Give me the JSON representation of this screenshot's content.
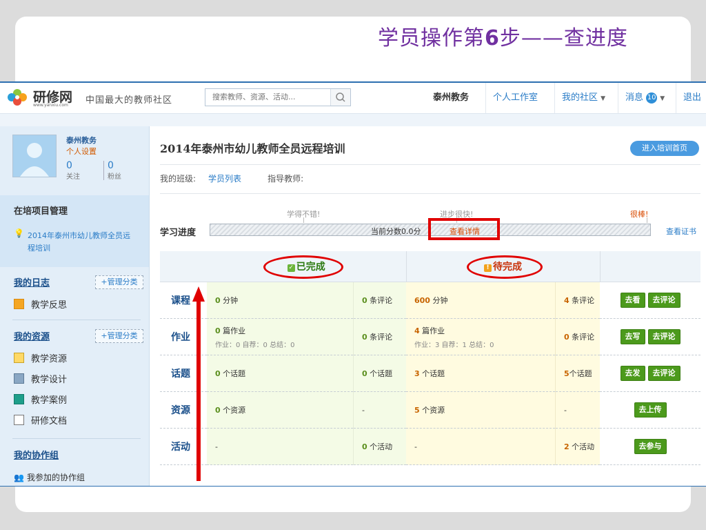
{
  "slide": {
    "title_prefix": "学员操作第",
    "title_num": "6",
    "title_suffix": "步——查进度"
  },
  "header": {
    "logo_text": "研修网",
    "logo_sub": "www.yanxiu.com",
    "slogan": "中国最大的教师社区",
    "search_placeholder": "搜索教师、资源、活动...",
    "nav_user": "泰州教务",
    "nav_studio": "个人工作室",
    "nav_community": "我的社区",
    "nav_messages": "消息",
    "msg_count": "10",
    "nav_logout": "退出"
  },
  "sidebar": {
    "name": "泰州教务",
    "settings": "个人设置",
    "follow_count": "0",
    "follow_label": "关注",
    "fans_count": "0",
    "fans_label": "粉丝",
    "project_title": "在培项目管理",
    "project_link_1": "2014年泰州市幼儿教师全员远",
    "project_link_2": "程培训",
    "diary_title": "我的日志",
    "manage_label": "+管理分类",
    "diary_item": "教学反思",
    "resource_title": "我的资源",
    "resource_items": [
      "教学资源",
      "教学设计",
      "教学案例",
      "研修文档"
    ],
    "group_title": "我的协作组",
    "group_item": "我参加的协作组"
  },
  "main": {
    "title": "2014年泰州市幼儿教师全员远程培训",
    "enter_button": "进入培训首页",
    "class_label": "我的班级:",
    "student_list": "学员列表",
    "tutor_label": "指导教师:",
    "progress_label": "学习进度",
    "marker_1": "学得不错!",
    "marker_2": "进步很快!",
    "marker_3": "很棒!",
    "score_text": "当前分数0.0分",
    "detail_link": "查看详情",
    "cert_link": "查看证书",
    "header_done": "已完成",
    "header_todo": "待完成"
  },
  "table": {
    "rows": [
      {
        "name": "课程",
        "done_main": "分钟",
        "done_num": "0",
        "done_count": "0",
        "done_unit": "条评论",
        "todo_num": "600",
        "todo_main": "分钟",
        "todo_count": "4",
        "todo_unit": "条评论",
        "btn1": "去看",
        "btn2": "去评论"
      },
      {
        "name": "作业",
        "done_num": "0",
        "done_main": "篇作业",
        "done_sub": "作业：0   自荐：0   总结：0",
        "done_count": "0",
        "done_unit": "条评论",
        "todo_num": "4",
        "todo_main": "篇作业",
        "todo_sub": "作业：3   自荐：1   总结：0",
        "todo_count": "0",
        "todo_unit": "条评论",
        "btn1": "去写",
        "btn2": "去评论"
      },
      {
        "name": "话题",
        "done_num": "0",
        "done_main": "个话题",
        "done_count": "0",
        "done_unit": "个话题",
        "todo_num": "3",
        "todo_main": "个话题",
        "todo_count": "5",
        "todo_unit": "个话题",
        "btn1": "去发",
        "btn2": "去评论"
      },
      {
        "name": "资源",
        "done_num": "0",
        "done_main": "个资源",
        "done_other": "-",
        "todo_num": "5",
        "todo_main": "个资源",
        "todo_other": "-",
        "btn1": "去上传"
      },
      {
        "name": "活动",
        "done_main": "-",
        "done_count": "0",
        "done_unit": "个活动",
        "todo_main": "-",
        "todo_count": "2",
        "todo_unit": "个活动",
        "btn1": "去参与"
      }
    ]
  },
  "colors": {
    "title_purple": "#7030a0",
    "link_blue": "#2a7cc7",
    "annotation_red": "#e00000",
    "button_green": "#4c9a1c"
  }
}
